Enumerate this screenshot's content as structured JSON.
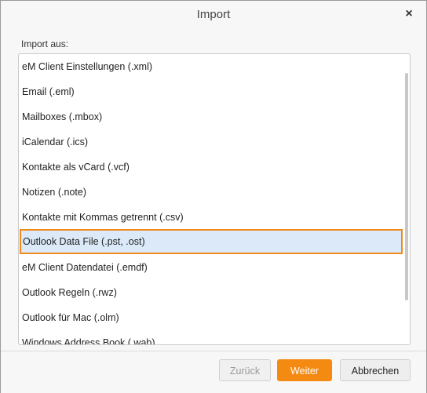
{
  "dialog": {
    "title": "Import",
    "close_icon": "×"
  },
  "import": {
    "label": "Import aus:",
    "items": [
      {
        "label": "eM Client Einstellungen (.xml)"
      },
      {
        "label": "Email (.eml)"
      },
      {
        "label": "Mailboxes (.mbox)"
      },
      {
        "label": "iCalendar (.ics)"
      },
      {
        "label": "Kontakte als vCard (.vcf)"
      },
      {
        "label": "Notizen (.note)"
      },
      {
        "label": "Kontakte mit Kommas getrennt (.csv)"
      },
      {
        "label": "Outlook Data File (.pst, .ost)",
        "selected": true
      },
      {
        "label": "eM Client Datendatei (.emdf)"
      },
      {
        "label": "Outlook Regeln (.rwz)"
      },
      {
        "label": "Outlook für Mac (.olm)"
      },
      {
        "label": "Windows Address Book (.wab)"
      }
    ]
  },
  "footer": {
    "back_label": "Zurück",
    "next_label": "Weiter",
    "cancel_label": "Abbrechen"
  },
  "colors": {
    "accent": "#f58a12",
    "selection_bg": "#dbe9f8",
    "selection_border": "#f08a1c"
  }
}
